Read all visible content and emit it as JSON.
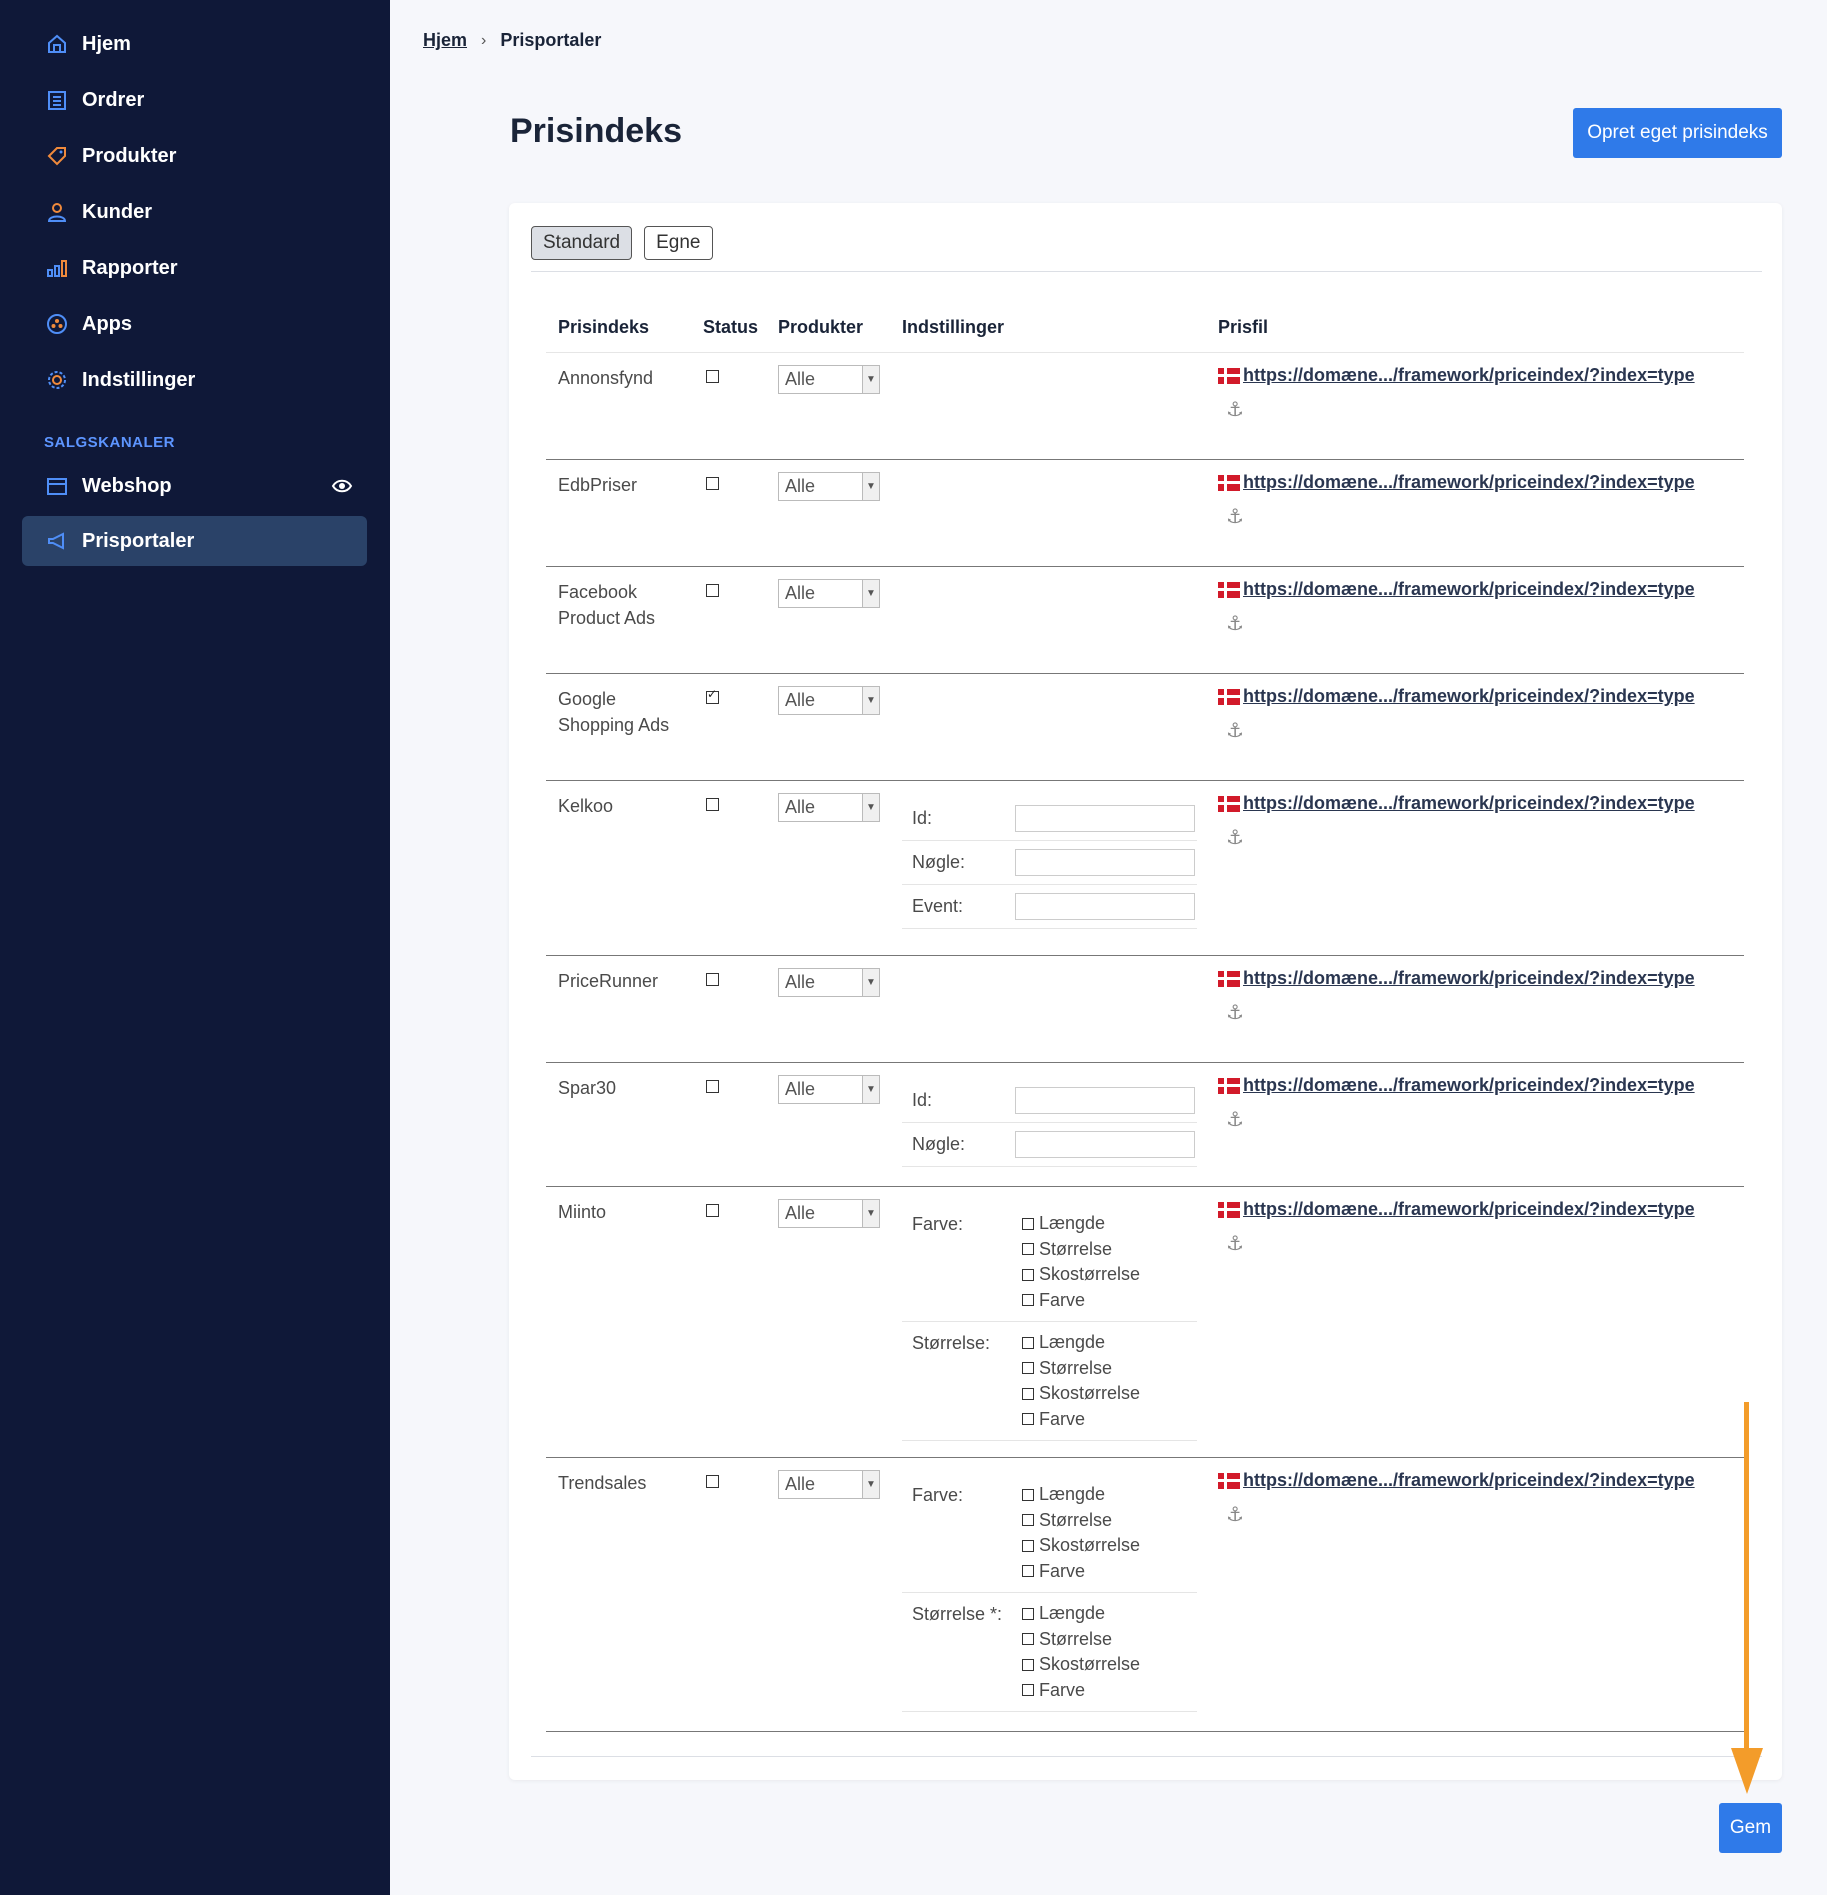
{
  "sidebar": {
    "items": [
      {
        "label": "Hjem",
        "icon": "home-icon"
      },
      {
        "label": "Ordrer",
        "icon": "orders-icon"
      },
      {
        "label": "Produkter",
        "icon": "tag-icon"
      },
      {
        "label": "Kunder",
        "icon": "user-icon"
      },
      {
        "label": "Rapporter",
        "icon": "chart-icon"
      },
      {
        "label": "Apps",
        "icon": "apps-icon"
      },
      {
        "label": "Indstillinger",
        "icon": "gear-icon"
      }
    ],
    "section_title": "SALGSKANALER",
    "channels": [
      {
        "label": "Webshop",
        "icon": "store-icon"
      },
      {
        "label": "Prisportaler",
        "icon": "megaphone-icon",
        "active": true
      }
    ]
  },
  "breadcrumb": {
    "home": "Hjem",
    "current": "Prisportaler"
  },
  "page_title": "Prisindeks",
  "create_button": "Opret eget prisindeks",
  "tabs": [
    "Standard",
    "Egne"
  ],
  "table": {
    "headers": {
      "name": "Prisindeks",
      "status": "Status",
      "products": "Produkter",
      "settings": "Indstillinger",
      "file": "Prisfil"
    },
    "url_text": "https://domæne.../framework/priceindex/?index=type",
    "select_value": "Alle",
    "anchor_glyph": "⚓",
    "rows": [
      {
        "name": "Annonsfynd",
        "checked": false
      },
      {
        "name": "EdbPriser",
        "checked": false
      },
      {
        "name": "Facebook Product Ads",
        "checked": false
      },
      {
        "name": "Google Shopping Ads",
        "checked": true
      },
      {
        "name": "Kelkoo",
        "checked": false,
        "fields": [
          "Id:",
          "Nøgle:",
          "Event:"
        ]
      },
      {
        "name": "PriceRunner",
        "checked": false
      },
      {
        "name": "Spar30",
        "checked": false,
        "fields": [
          "Id:",
          "Nøgle:"
        ]
      },
      {
        "name": "Miinto",
        "checked": false,
        "options": [
          {
            "label": "Farve:",
            "choices": [
              "Længde",
              "Størrelse",
              "Skostørrelse",
              "Farve"
            ]
          },
          {
            "label": "Størrelse:",
            "choices": [
              "Længde",
              "Størrelse",
              "Skostørrelse",
              "Farve"
            ]
          }
        ]
      },
      {
        "name": "Trendsales",
        "checked": false,
        "options": [
          {
            "label": "Farve:",
            "choices": [
              "Længde",
              "Størrelse",
              "Skostørrelse",
              "Farve"
            ]
          },
          {
            "label": "Størrelse *:",
            "choices": [
              "Længde",
              "Størrelse",
              "Skostørrelse",
              "Farve"
            ]
          }
        ]
      }
    ]
  },
  "save_button": "Gem",
  "colors": {
    "sidebar_bg": "#0f1838",
    "active_bg": "#2a4268",
    "accent": "#2f7ae9",
    "section": "#5d95ff",
    "annotation_arrow": "#f39c2a"
  }
}
